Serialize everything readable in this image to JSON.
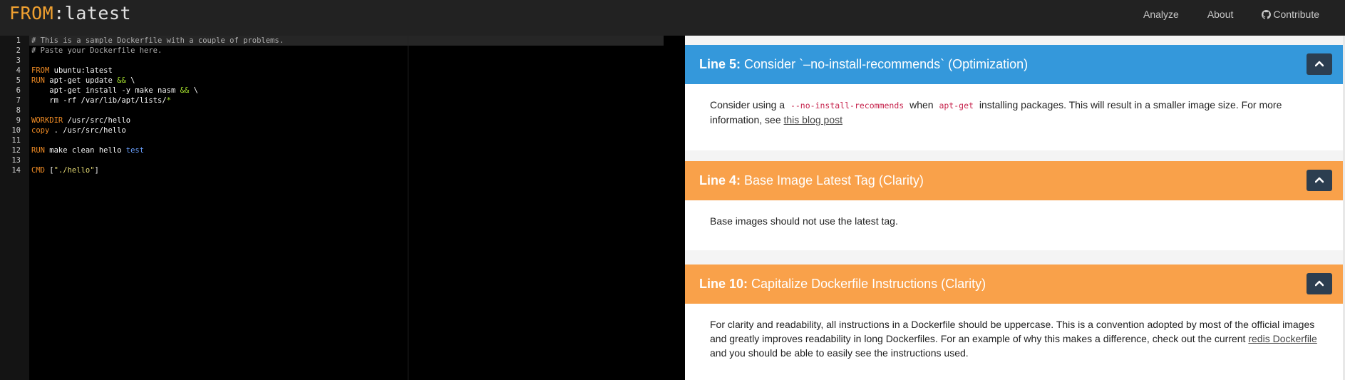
{
  "brand": {
    "from": "FROM",
    "tag": ":latest"
  },
  "nav": {
    "analyze": "Analyze",
    "about": "About",
    "contribute": "Contribute",
    "contribute_icon": "github-icon"
  },
  "editor": {
    "line_numbers": [
      "1",
      "2",
      "3",
      "4",
      "5",
      "6",
      "7",
      "8",
      "9",
      "10",
      "11",
      "12",
      "13",
      "14"
    ],
    "lines": {
      "l1": "# This is a sample Dockerfile with a couple of problems.",
      "l2": "# Paste your Dockerfile here.",
      "l4_kw": "FROM",
      "l4_rest": " ubuntu:latest",
      "l5_kw": "RUN",
      "l5_a": " apt-get update ",
      "l5_op": "&&",
      "l5_b": " \\",
      "l6_a": "    apt-get install -y make nasm ",
      "l6_op": "&&",
      "l6_b": " \\",
      "l7_a": "    rm -rf /var/lib/apt/lists/",
      "l7_op": "*",
      "l9_kw": "WORKDIR",
      "l9_rest": " /usr/src/hello",
      "l10_kw": "copy",
      "l10_rest": " . /usr/src/hello",
      "l12_kw": "RUN",
      "l12_rest": " make clean hello ",
      "l12_test": "test",
      "l14_kw": "CMD",
      "l14_a": " [",
      "l14_str": "\"./hello\"",
      "l14_b": "]"
    }
  },
  "results": {
    "cards": [
      {
        "line_label": "Line 5:",
        "title": "Consider `--no-install-recommends` (Optimization)",
        "title_display": "Consider `–no-install-recommends` (Optimization)",
        "body_pre": "Consider using a",
        "body_code1": "--no-install-recommends",
        "body_mid": "when",
        "body_code2": "apt-get",
        "body_post": "installing packages. This will result in a smaller image size. For more information, see",
        "link": "this blog post",
        "color": "#3498db"
      },
      {
        "line_label": "Line 4:",
        "title": "Base Image Latest Tag (Clarity)",
        "body": "Base images should not use the latest tag.",
        "color": "#f9a14a"
      },
      {
        "line_label": "Line 10:",
        "title": "Capitalize Dockerfile Instructions (Clarity)",
        "body_pre": "For clarity and readability, all instructions in a Dockerfile should be uppercase. This is a convention adopted by most of the official images and greatly improves readability in long Dockerfiles. For an example of why this makes a difference, check out the current",
        "link": "redis Dockerfile",
        "body_post": "and you should be able to easily see the instructions used.",
        "color": "#f9a14a"
      }
    ],
    "collapse_icon": "chevron-up-icon"
  }
}
